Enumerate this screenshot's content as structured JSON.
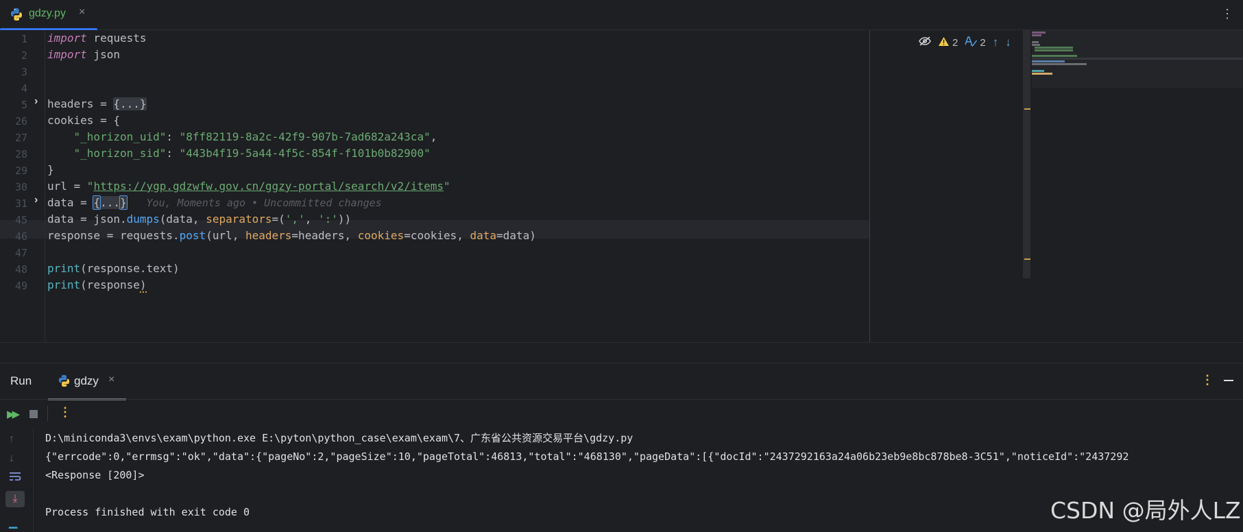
{
  "editor_tab": {
    "filename": "gdzy.py",
    "close": "×"
  },
  "gutter": {
    "line_numbers": [
      "1",
      "2",
      "3",
      "4",
      "5",
      "26",
      "27",
      "28",
      "29",
      "30",
      "31",
      "45",
      "46",
      "47",
      "48",
      "49"
    ],
    "fold_glyph": "›"
  },
  "code": {
    "l1_kw": "import",
    "l1_rest": " requests",
    "l2_kw": "import",
    "l2_rest": " json",
    "l5_pre": "headers = ",
    "l5_fold": "{...}",
    "l26": "cookies = {",
    "l27_indent": "    ",
    "l27_key": "\"_horizon_uid\"",
    "l27_colon": ": ",
    "l27_val": "\"8ff82119-8a2c-42f9-907b-7ad682a243ca\"",
    "l27_comma": ",",
    "l28_indent": "    ",
    "l28_key": "\"_horizon_sid\"",
    "l28_colon": ": ",
    "l28_val": "\"443b4f19-5a44-4f5c-854f-f101b0b82900\"",
    "l29": "}",
    "l30_pre": "url = ",
    "l30_q1": "\"",
    "l30_url": "https://ygp.gdzwfw.gov.cn/ggzy-portal/search/v2/items",
    "l30_q2": "\"",
    "l31_pre": "data = ",
    "l31_open": "{",
    "l31_dots": "...",
    "l31_close": "}",
    "l31_inlay": "You, Moments ago • Uncommitted changes",
    "l45_a": "data = json.",
    "l45_fn": "dumps",
    "l45_b": "(data, ",
    "l45_param": "separators",
    "l45_c": "=(",
    "l45_s1": "','",
    "l45_d": ", ",
    "l45_s2": "':'",
    "l45_e": "))",
    "l46_a": "response = requests.",
    "l46_fn": "post",
    "l46_b": "(url, ",
    "l46_p1": "headers",
    "l46_c": "=headers, ",
    "l46_p2": "cookies",
    "l46_d": "=cookies, ",
    "l46_p3": "data",
    "l46_e": "=data)",
    "l48_fn": "print",
    "l48_rest": "(response.text)",
    "l49_fn": "print",
    "l49_rest": "(response",
    "l49_close": ")"
  },
  "inspections": {
    "warnings": "2",
    "typos": "2"
  },
  "run_panel": {
    "title": "Run",
    "tab_name": "gdzy",
    "close": "×"
  },
  "console": {
    "line1": "D:\\miniconda3\\envs\\exam\\python.exe E:\\pyton\\python_case\\exam\\exam\\7、广东省公共资源交易平台\\gdzy.py",
    "line2": "{\"errcode\":0,\"errmsg\":\"ok\",\"data\":{\"pageNo\":2,\"pageSize\":10,\"pageTotal\":46813,\"total\":\"468130\",\"pageData\":[{\"docId\":\"2437292163a24a06b23eb9e8bc878be8-3C51\",\"noticeId\":\"2437292",
    "line3": "<Response [200]>",
    "line5": "Process finished with exit code 0"
  },
  "watermark": "CSDN @局外人LZ",
  "colors": {
    "accent": "#3574f0",
    "keyword": "#c77dbb",
    "string": "#6aab73",
    "function": "#56a8f5",
    "param": "#e0a961",
    "builtin": "#56b6c2"
  },
  "icons": [
    "python-file-icon",
    "close-icon",
    "more-vertical-icon",
    "fold-arrow-icon",
    "reader-mode-icon",
    "warning-icon",
    "typo-icon",
    "prev-highlight-icon",
    "next-highlight-icon",
    "rerun-icon",
    "stop-icon",
    "minimize-icon",
    "scroll-up-icon",
    "scroll-down-icon",
    "soft-wrap-icon",
    "scroll-to-end-icon"
  ]
}
